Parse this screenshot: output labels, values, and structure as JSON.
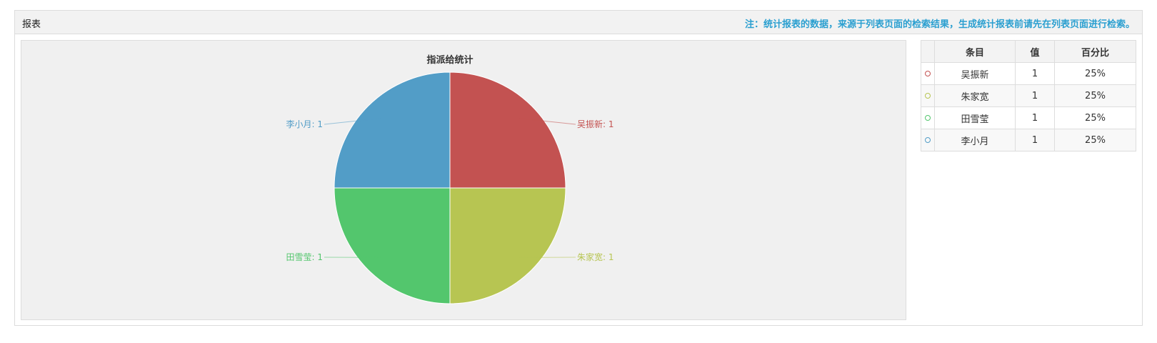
{
  "panel": {
    "title": "报表",
    "note": "注：统计报表的数据，来源于列表页面的检索结果，生成统计报表前请先在列表页面进行检索。"
  },
  "chart_data": {
    "type": "pie",
    "title": "指派给统计",
    "slices": [
      {
        "label": "吴振新",
        "value": 1,
        "color": "#c35251",
        "slice_label": "吴振新: 1"
      },
      {
        "label": "朱家宽",
        "value": 1,
        "color": "#b7c552",
        "slice_label": "朱家宽: 1"
      },
      {
        "label": "田雪莹",
        "value": 1,
        "color": "#53c66d",
        "slice_label": "田雪莹: 1"
      },
      {
        "label": "李小月",
        "value": 1,
        "color": "#529dc7",
        "slice_label": "李小月: 1"
      }
    ]
  },
  "table": {
    "headers": [
      "条目",
      "值",
      "百分比"
    ],
    "rows": [
      {
        "name": "吴振新",
        "value": "1",
        "percent": "25%",
        "color": "#c35251"
      },
      {
        "name": "朱家宽",
        "value": "1",
        "percent": "25%",
        "color": "#b7c552"
      },
      {
        "name": "田雪莹",
        "value": "1",
        "percent": "25%",
        "color": "#53c66d"
      },
      {
        "name": "李小月",
        "value": "1",
        "percent": "25%",
        "color": "#529dc7"
      }
    ]
  }
}
